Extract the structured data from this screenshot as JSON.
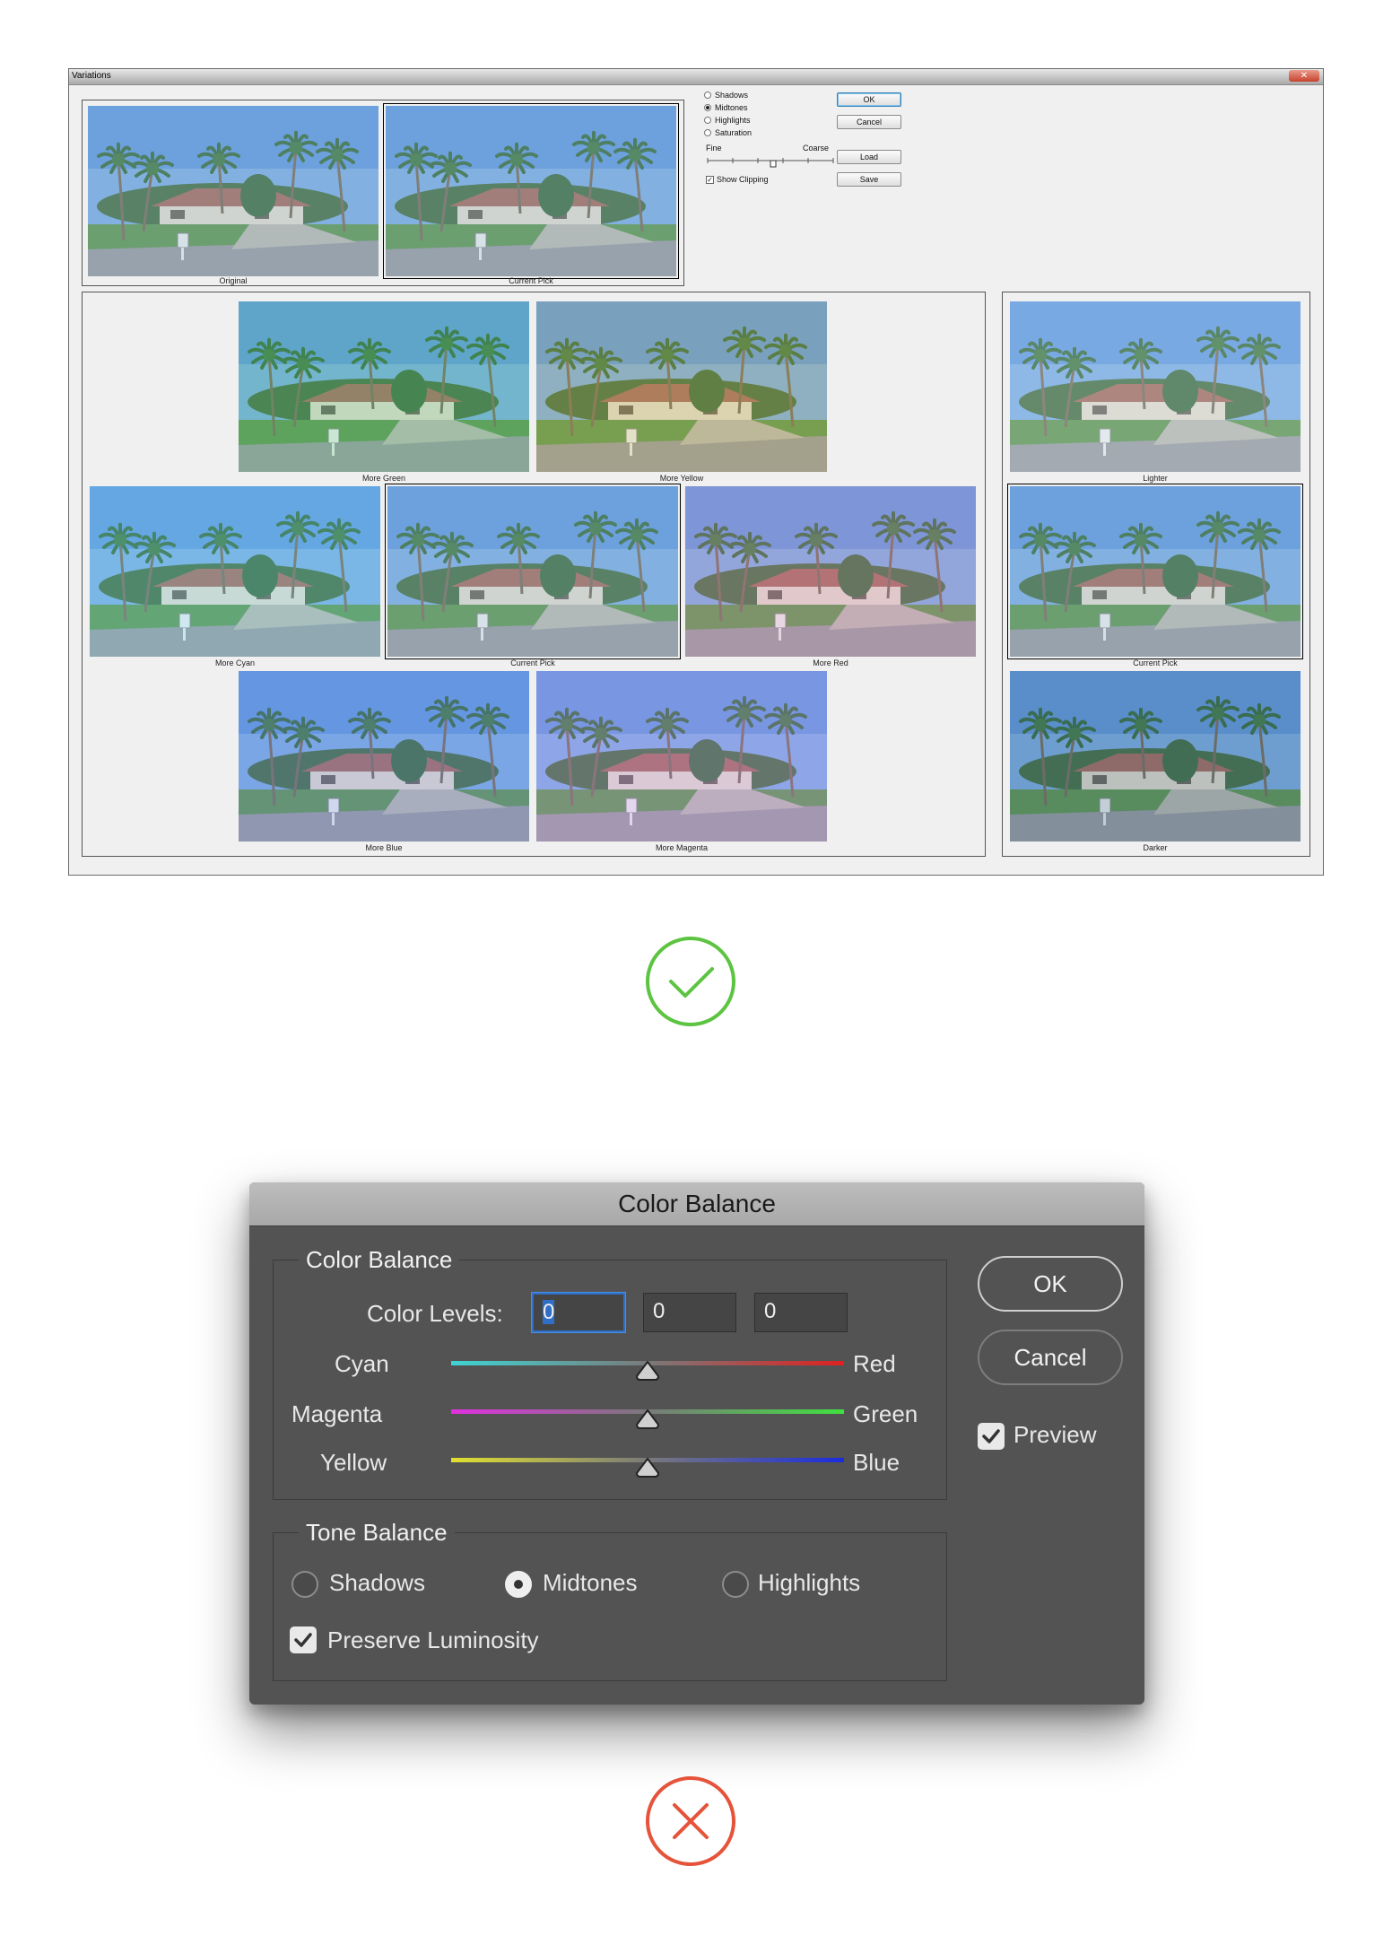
{
  "variations": {
    "title": "Variations",
    "original_label": "Original",
    "current_pick_label": "Current Pick",
    "tones": [
      {
        "label": "Shadows",
        "selected": false
      },
      {
        "label": "Midtones",
        "selected": true
      },
      {
        "label": "Highlights",
        "selected": false
      },
      {
        "label": "Saturation",
        "selected": false
      }
    ],
    "fine_label": "Fine",
    "coarse_label": "Coarse",
    "show_clipping_label": "Show Clipping",
    "show_clipping_checked": true,
    "buttons": {
      "ok": "OK",
      "cancel": "Cancel",
      "load": "Load",
      "save": "Save"
    },
    "color_variants": [
      {
        "label": "More Green",
        "tint": "#7fd0a0"
      },
      {
        "label": "More Yellow",
        "tint": "#c8c27a"
      },
      {
        "label": "More Cyan",
        "tint": "#8fd6e6"
      },
      {
        "label": "Current Pick",
        "tint": "#a6c6d8"
      },
      {
        "label": "More Red",
        "tint": "#d6a6c8"
      },
      {
        "label": "More Blue",
        "tint": "#8ea6e6"
      },
      {
        "label": "More Magenta",
        "tint": "#c8a6e8"
      }
    ],
    "brightness_variants": [
      {
        "label": "Lighter"
      },
      {
        "label": "Current Pick"
      },
      {
        "label": "Darker"
      }
    ]
  },
  "status": {
    "good_icon": "check-circle-icon",
    "bad_icon": "x-circle-icon",
    "good_color": "#5cc440",
    "bad_color": "#e5533a"
  },
  "color_balance": {
    "title": "Color Balance",
    "group_title": "Color Balance",
    "color_levels_label": "Color Levels:",
    "levels": [
      "0",
      "0",
      "0"
    ],
    "sliders": [
      {
        "left": "Cyan",
        "right": "Red",
        "value": 0
      },
      {
        "left": "Magenta",
        "right": "Green",
        "value": 0
      },
      {
        "left": "Yellow",
        "right": "Blue",
        "value": 0
      }
    ],
    "tone_group_title": "Tone Balance",
    "tones": [
      {
        "label": "Shadows",
        "selected": false
      },
      {
        "label": "Midtones",
        "selected": true
      },
      {
        "label": "Highlights",
        "selected": false
      }
    ],
    "preserve_luminosity_label": "Preserve Luminosity",
    "preserve_luminosity_checked": true,
    "ok_label": "OK",
    "cancel_label": "Cancel",
    "preview_label": "Preview",
    "preview_checked": true
  }
}
